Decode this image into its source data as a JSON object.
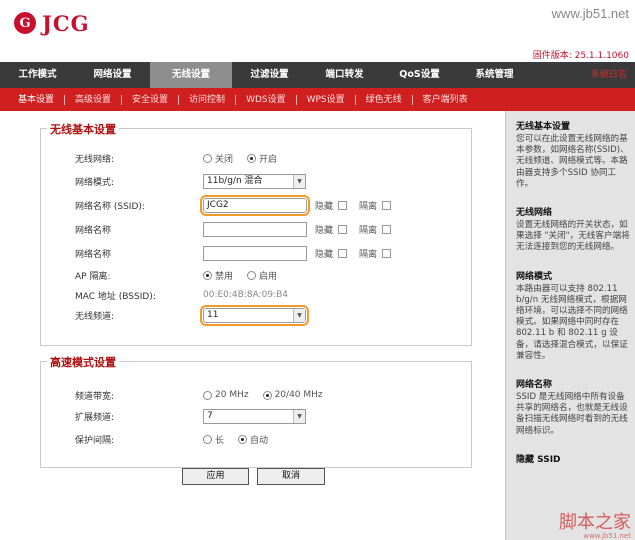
{
  "header": {
    "logo_mark": "G",
    "logo_text": "JCG",
    "watermark": "www.jb51.net",
    "firmware": "固件版本: 25.1.1.1060"
  },
  "main_nav": [
    "工作模式",
    "网络设置",
    "无线设置",
    "过滤设置",
    "端口转发",
    "QoS设置",
    "系统管理",
    "系统日志"
  ],
  "main_nav_active": 2,
  "sub_nav": [
    "基本设置",
    "高级设置",
    "安全设置",
    "访问控制",
    "WDS设置",
    "WPS设置",
    "绿色无线",
    "客户端列表"
  ],
  "sub_nav_active": 0,
  "basic": {
    "legend": "无线基本设置",
    "wireless_label": "无线网络:",
    "wireless_off": "关闭",
    "wireless_on": "开启",
    "mode_label": "网络模式:",
    "mode_value": "11b/g/n 混合",
    "ssid_label": "网络名称 (SSID):",
    "ssid_value": "JCG2",
    "ssid2_label": "网络名称",
    "ssid3_label": "网络名称",
    "hide_label": "隐藏",
    "isolate_label": "隔离",
    "ap_isolate_label": "AP 隔离:",
    "ap_disable": "禁用",
    "ap_enable": "启用",
    "mac_label": "MAC 地址 (BSSID):",
    "mac_value": "00:E0:4B:8A:09:B4",
    "channel_label": "无线频道:",
    "channel_value": "11"
  },
  "advanced": {
    "legend": "高速模式设置",
    "bandwidth_label": "频道带宽:",
    "bw_20": "20 MHz",
    "bw_2040": "20/40 MHz",
    "ext_label": "扩展频道:",
    "ext_value": "7",
    "guard_label": "保护间隔:",
    "guard_long": "长",
    "guard_auto": "自动"
  },
  "buttons": {
    "apply": "应用",
    "cancel": "取消"
  },
  "help": [
    {
      "title": "无线基本设置",
      "text": "您可以在此设置无线网络的基本参数，如网络名称(SSID)、无线频道、网络模式等。本路由器支持多个SSID 协同工作。"
    },
    {
      "title": "无线网络",
      "text": "设置无线网络的开关状态，如果选择 \"关闭\"，无线客户端将无法连接到您的无线网络。"
    },
    {
      "title": "网络模式",
      "text": "本路由器可以支持 802.11 b/g/n 无线网络模式，根据网络环境，可以选择不同的网络模式。如果网络中同时存在 802.11 b 和 802.11 g 设备，请选择混合模式，以保证兼容性。"
    },
    {
      "title": "网络名称",
      "text": "SSID 是无线网络中所有设备共享的网络名，也就是无线设备扫描无线网络时看到的无线网络标识。"
    },
    {
      "title": "隐藏 SSID",
      "text": ""
    }
  ],
  "watermark_bottom": "脚本之家",
  "watermark_url": "www.jb51.net"
}
